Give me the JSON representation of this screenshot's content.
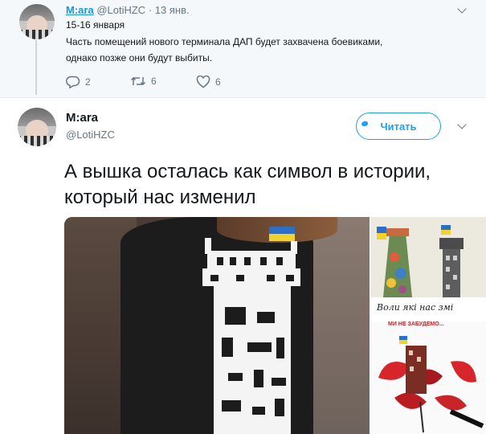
{
  "parent_tweet": {
    "author_name": "M:ara",
    "author_handle": "@LotiHZC",
    "separator": "·",
    "date": "13 янв.",
    "text_line1": "15-16 января",
    "text_line2": "Часть помещений нового терминала ДАП будет захвачена  боевиками,",
    "text_line3": "однако позже они будут выбиты.",
    "reply_count": "2",
    "retweet_count": "6",
    "like_count": "6"
  },
  "main_tweet": {
    "author_name": "M:ara",
    "author_handle": "@LotiHZC",
    "follow_label": "Читать",
    "text": "А вышка осталась как символ в истории, который нас изменил"
  },
  "media": {
    "top_right_caption": "Воли які нас змі",
    "bottom_right_caption": "МИ НЕ ЗАБУДЕМО..."
  },
  "colors": {
    "accent": "#1da1f2",
    "link": "#1b95e0",
    "muted": "#657786",
    "text": "#14171a",
    "thread_bg": "#f5f8fa"
  },
  "icons": [
    "reply-icon",
    "retweet-icon",
    "like-icon",
    "chevron-down-icon",
    "avatar"
  ]
}
